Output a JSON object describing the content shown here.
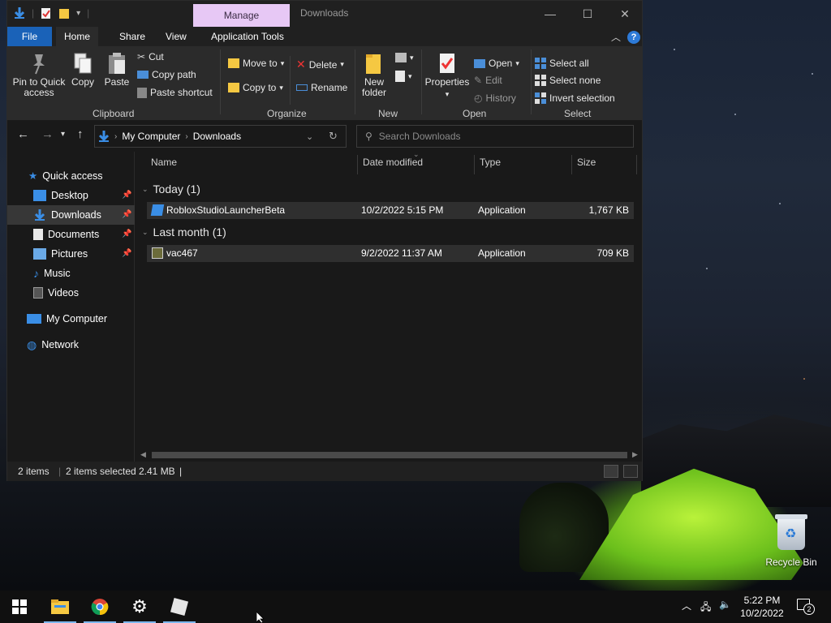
{
  "window": {
    "context_tab": "Manage",
    "title": "Downloads",
    "controls": {
      "minimize": "—",
      "maximize": "☐",
      "close": "✕"
    }
  },
  "ribbon_tabs": {
    "file": "File",
    "home": "Home",
    "share": "Share",
    "view": "View",
    "app_tools": "Application Tools"
  },
  "ribbon": {
    "clipboard": {
      "label": "Clipboard",
      "pin": "Pin to Quick access",
      "copy": "Copy",
      "paste": "Paste",
      "cut": "Cut",
      "copy_path": "Copy path",
      "paste_shortcut": "Paste shortcut"
    },
    "organize": {
      "label": "Organize",
      "move_to": "Move to",
      "copy_to": "Copy to",
      "delete": "Delete",
      "rename": "Rename"
    },
    "new": {
      "label": "New",
      "new_folder": "New folder"
    },
    "open": {
      "label": "Open",
      "properties": "Properties",
      "open": "Open",
      "edit": "Edit",
      "history": "History"
    },
    "select": {
      "label": "Select",
      "select_all": "Select all",
      "select_none": "Select none",
      "invert": "Invert selection"
    }
  },
  "address": {
    "path": [
      "My Computer",
      "Downloads"
    ]
  },
  "search": {
    "placeholder": "Search Downloads"
  },
  "nav": {
    "quick_access": "Quick access",
    "items": [
      {
        "label": "Desktop",
        "pinned": true
      },
      {
        "label": "Downloads",
        "pinned": true,
        "selected": true
      },
      {
        "label": "Documents",
        "pinned": true
      },
      {
        "label": "Pictures",
        "pinned": true
      },
      {
        "label": "Music",
        "pinned": false
      },
      {
        "label": "Videos",
        "pinned": false
      }
    ],
    "my_computer": "My Computer",
    "network": "Network"
  },
  "columns": {
    "name": "Name",
    "date": "Date modified",
    "type": "Type",
    "size": "Size"
  },
  "groups": [
    {
      "label": "Today (1)",
      "files": [
        {
          "name": "RobloxStudioLauncherBeta",
          "date": "10/2/2022 5:15 PM",
          "type": "Application",
          "size": "1,767 KB"
        }
      ]
    },
    {
      "label": "Last month (1)",
      "files": [
        {
          "name": "vac467",
          "date": "9/2/2022 11:37 AM",
          "type": "Application",
          "size": "709 KB"
        }
      ]
    }
  ],
  "status": {
    "items": "2 items",
    "selected": "2 items selected",
    "size": "2.41 MB",
    "cursor": "|"
  },
  "desktop": {
    "recycle_bin": "Recycle Bin"
  },
  "taskbar": {
    "time": "5:22 PM",
    "date": "10/2/2022",
    "notif_count": "2"
  },
  "colors": {
    "accent": "#1a62b8",
    "manage": "#e7c8f5",
    "selection": "#373737"
  }
}
